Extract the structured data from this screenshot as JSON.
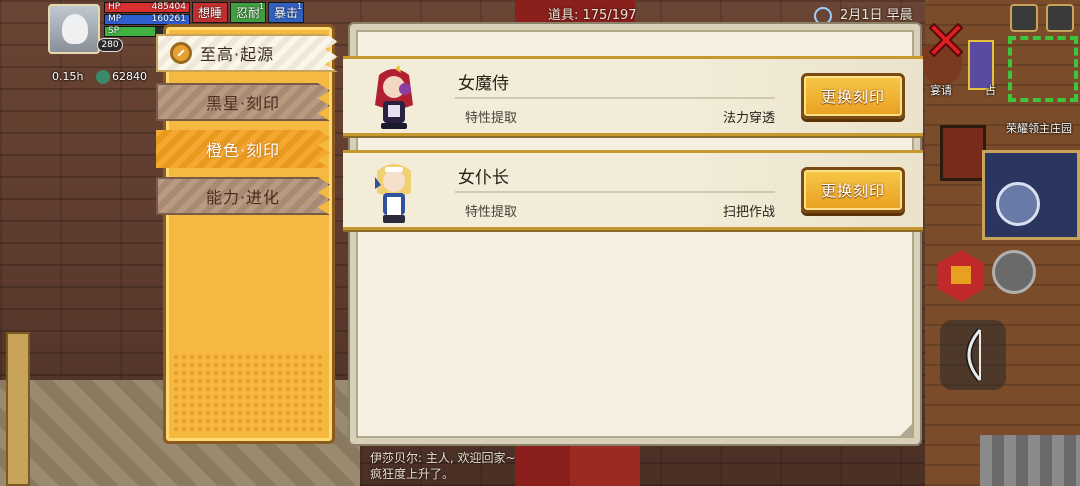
{
  "hud": {
    "hp_label": "HP",
    "hp_value": "485404",
    "mp_label": "MP",
    "mp_value": "160261",
    "sp_label": "SP",
    "level": "280",
    "time": "0.15h",
    "gold": "62840",
    "status_tabs": [
      {
        "label": "想睡",
        "sup": ""
      },
      {
        "label": "忍耐",
        "sup": "1"
      },
      {
        "label": "暴击",
        "sup": "1"
      }
    ],
    "items_label": "道具: 175/197",
    "date_label": "2月1日 早晨"
  },
  "world": {
    "label_invite": "宴请",
    "label_oc": "占",
    "label_village": "荣耀领主庄园",
    "chat_line1": "伊莎贝尔: 主人, 欢迎回家~",
    "chat_line2": "疯狂度上升了。"
  },
  "tabs": [
    {
      "label": "至高·起源",
      "state": "active"
    },
    {
      "label": "黑星·刻印",
      "state": "inactive"
    },
    {
      "label": "橙色·刻印",
      "state": "orange"
    },
    {
      "label": "能力·进化",
      "state": "inactive"
    }
  ],
  "cards": [
    {
      "name": "女魔侍",
      "sub": "特性提取",
      "trait": "法力穿透",
      "button": "更换刻印"
    },
    {
      "name": "女仆长",
      "sub": "特性提取",
      "trait": "扫把作战",
      "button": "更换刻印"
    }
  ],
  "colors": {
    "accent_gold": "#f5b840",
    "button_gold": "#e8a020",
    "panel_bg": "#f5f0e2",
    "close_red": "#e02020"
  },
  "icons": {
    "close": "close-icon",
    "active_tab": "ring-check-icon"
  }
}
